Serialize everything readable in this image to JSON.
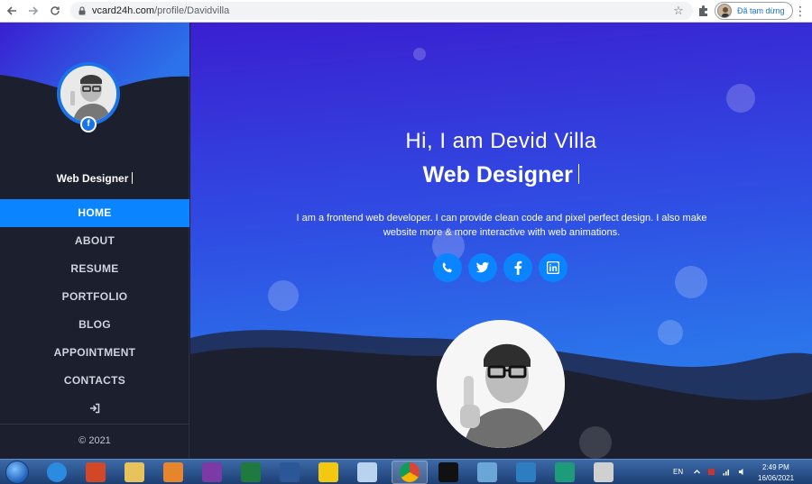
{
  "browser": {
    "url_domain": "vcard24h.com",
    "url_path": "/profile/Davidvilla",
    "profile_status": "Đã tạm dừng"
  },
  "sidebar": {
    "title": "Web Designer",
    "menu": [
      {
        "label": "HOME",
        "active": true
      },
      {
        "label": "ABOUT",
        "active": false
      },
      {
        "label": "RESUME",
        "active": false
      },
      {
        "label": "PORTFOLIO",
        "active": false
      },
      {
        "label": "BLOG",
        "active": false
      },
      {
        "label": "APPOINTMENT",
        "active": false
      },
      {
        "label": "CONTACTS",
        "active": false
      }
    ],
    "footer": "© 2021"
  },
  "hero": {
    "greeting": "Hi, I am Devid Villa",
    "role": "Web Designer",
    "description": "I am a frontend web developer. I can provide clean code and pixel perfect design. I also make website more & more interactive with web animations.",
    "socials": [
      "phone-icon",
      "twitter-icon",
      "facebook-icon",
      "linkedin-icon"
    ]
  },
  "taskbar": {
    "language": "EN",
    "time": "2:49 PM",
    "date": "16/06/2021"
  },
  "colors": {
    "accent": "#0a84ff",
    "sidebar_bg": "#1b1f2e",
    "hero_top": "#3a1fd1",
    "hero_bottom": "#2d7ef0"
  }
}
